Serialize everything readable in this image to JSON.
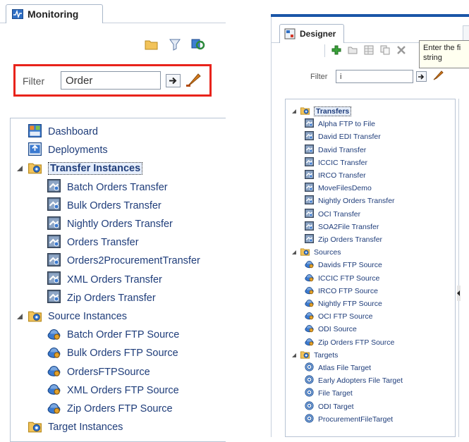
{
  "left": {
    "tab": "Monitoring",
    "filter_label": "Filter",
    "filter_value": "Order",
    "toolbar_icons": [
      "folder-icon",
      "funnel-icon",
      "refresh-icon"
    ],
    "tree": [
      {
        "label": "Dashboard",
        "icon": "dashboard-icon",
        "level": 0
      },
      {
        "label": "Deployments",
        "icon": "deployments-icon",
        "level": 0
      },
      {
        "label": "Transfer Instances",
        "icon": "folder-icon",
        "level": 0,
        "expanded": true,
        "selected": true
      },
      {
        "label": "Batch Orders Transfer",
        "icon": "transfer-icon",
        "level": 1
      },
      {
        "label": "Bulk Orders Transfer",
        "icon": "transfer-icon",
        "level": 1
      },
      {
        "label": "Nightly Orders Transfer",
        "icon": "transfer-icon",
        "level": 1
      },
      {
        "label": "Orders Transfer",
        "icon": "transfer-icon",
        "level": 1
      },
      {
        "label": "Orders2ProcurementTransfer",
        "icon": "transfer-icon",
        "level": 1
      },
      {
        "label": "XML Orders Transfer",
        "icon": "transfer-icon",
        "level": 1
      },
      {
        "label": "Zip Orders Transfer",
        "icon": "transfer-icon",
        "level": 1
      },
      {
        "label": "Source Instances",
        "icon": "folder-icon",
        "level": 0,
        "expanded": true
      },
      {
        "label": "Batch Order FTP Source",
        "icon": "source-icon",
        "level": 1
      },
      {
        "label": "Bulk Orders FTP Source",
        "icon": "source-icon",
        "level": 1
      },
      {
        "label": "OrdersFTPSource",
        "icon": "source-icon",
        "level": 1
      },
      {
        "label": "XML Orders FTP Source",
        "icon": "source-icon",
        "level": 1
      },
      {
        "label": "Zip Orders FTP Source",
        "icon": "source-icon",
        "level": 1
      },
      {
        "label": "Target Instances",
        "icon": "target-folder-icon",
        "level": 0
      }
    ]
  },
  "right": {
    "tab": "Designer",
    "filter_label": "Filter",
    "filter_value": "i",
    "tooltip_line1": "Enter the fi",
    "tooltip_line2": "string",
    "toolbar_icons": [
      "add-icon",
      "folder-icon",
      "table-icon",
      "copy-icon",
      "delete-icon"
    ],
    "tree": [
      {
        "label": "Transfers",
        "icon": "folder-icon",
        "level": 0,
        "expanded": true,
        "selected": true
      },
      {
        "label": "Alpha FTP to File",
        "icon": "transfer-icon",
        "level": 1
      },
      {
        "label": "David EDI Transfer",
        "icon": "transfer-icon",
        "level": 1
      },
      {
        "label": "David Transfer",
        "icon": "transfer-icon",
        "level": 1
      },
      {
        "label": "ICCIC Transfer",
        "icon": "transfer-icon",
        "level": 1
      },
      {
        "label": "IRCO Transfer",
        "icon": "transfer-icon",
        "level": 1
      },
      {
        "label": "MoveFilesDemo",
        "icon": "transfer-icon",
        "level": 1
      },
      {
        "label": "Nightly Orders Transfer",
        "icon": "transfer-icon",
        "level": 1
      },
      {
        "label": "OCI Transfer",
        "icon": "transfer-icon",
        "level": 1
      },
      {
        "label": "SOA2File Transfer",
        "icon": "transfer-icon",
        "level": 1
      },
      {
        "label": "Zip Orders Transfer",
        "icon": "transfer-icon",
        "level": 1
      },
      {
        "label": "Sources",
        "icon": "folder-icon",
        "level": 0,
        "expanded": true
      },
      {
        "label": "Davids FTP Source",
        "icon": "source-icon",
        "level": 1
      },
      {
        "label": "ICCIC FTP Source",
        "icon": "source-icon",
        "level": 1
      },
      {
        "label": "IRCO FTP Source",
        "icon": "source-icon",
        "level": 1
      },
      {
        "label": "Nightly FTP Source",
        "icon": "source-icon",
        "level": 1
      },
      {
        "label": "OCI FTP Source",
        "icon": "source-icon",
        "level": 1
      },
      {
        "label": "ODI Source",
        "icon": "source-icon",
        "level": 1
      },
      {
        "label": "Zip Orders FTP Source",
        "icon": "source-icon",
        "level": 1
      },
      {
        "label": "Targets",
        "icon": "target-folder-icon",
        "level": 0,
        "expanded": true
      },
      {
        "label": "Atlas File Target",
        "icon": "target-icon",
        "level": 1
      },
      {
        "label": "Early Adopters File Target",
        "icon": "target-icon",
        "level": 1
      },
      {
        "label": "File Target",
        "icon": "target-icon",
        "level": 1
      },
      {
        "label": "ODI Target",
        "icon": "target-icon",
        "level": 1
      },
      {
        "label": "ProcurementFileTarget",
        "icon": "target-icon",
        "level": 1
      }
    ]
  },
  "colors": {
    "highlight_border": "#e8231b",
    "text": "#1f3d7a",
    "panel_border": "#b8c4d4",
    "topbar": "#1a56a8"
  }
}
